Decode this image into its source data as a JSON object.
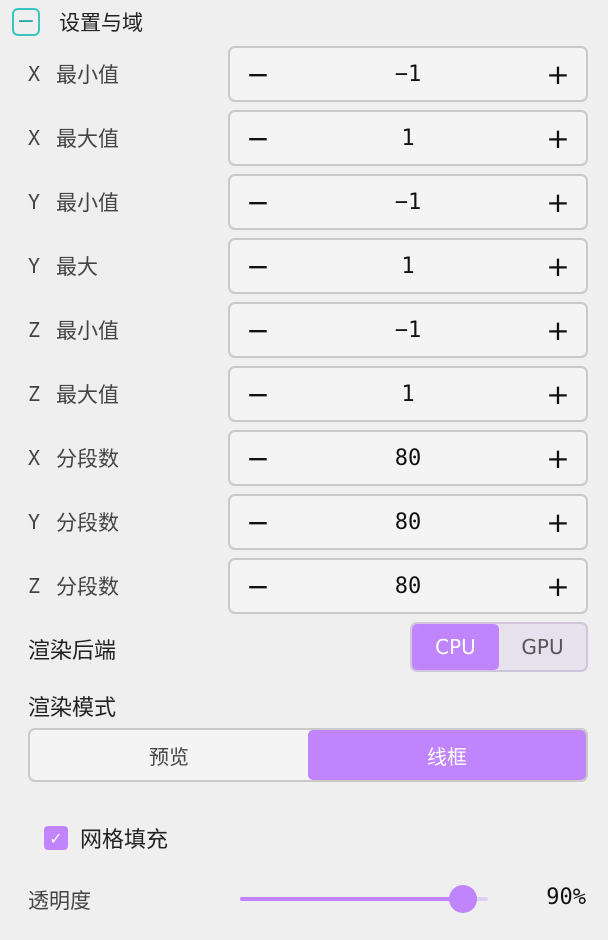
{
  "section": {
    "title": "设置与域",
    "collapse_symbol": "−"
  },
  "rows": [
    {
      "axis": "X",
      "label": "最小值",
      "value": "−1",
      "minus": "−",
      "plus": "+"
    },
    {
      "axis": "X",
      "label": "最大值",
      "value": "1",
      "minus": "−",
      "plus": "+"
    },
    {
      "axis": "Y",
      "label": "最小值",
      "value": "−1",
      "minus": "−",
      "plus": "+"
    },
    {
      "axis": "Y",
      "label": "最大",
      "value": "1",
      "minus": "−",
      "plus": "+"
    },
    {
      "axis": "Z",
      "label": "最小值",
      "value": "−1",
      "minus": "−",
      "plus": "+"
    },
    {
      "axis": "Z",
      "label": "最大值",
      "value": "1",
      "minus": "−",
      "plus": "+"
    },
    {
      "axis": "X",
      "label": "分段数",
      "value": "80",
      "minus": "−",
      "plus": "+"
    },
    {
      "axis": "Y",
      "label": "分段数",
      "value": "80",
      "minus": "−",
      "plus": "+"
    },
    {
      "axis": "Z",
      "label": "分段数",
      "value": "80",
      "minus": "−",
      "plus": "+"
    }
  ],
  "backend": {
    "label": "渲染后端",
    "options": [
      "CPU",
      "GPU"
    ],
    "selected": "CPU"
  },
  "render_mode": {
    "label": "渲染模式",
    "options": [
      "预览",
      "线框"
    ],
    "selected": "线框"
  },
  "mesh_fill": {
    "label": "网格填充",
    "checked": true,
    "check_symbol": "✓"
  },
  "opacity": {
    "label": "透明度",
    "value_percent": 90,
    "value_text": "90%"
  },
  "colors": {
    "accent": "#c084fc",
    "teal": "#3cc5c0",
    "background": "#efefef"
  }
}
